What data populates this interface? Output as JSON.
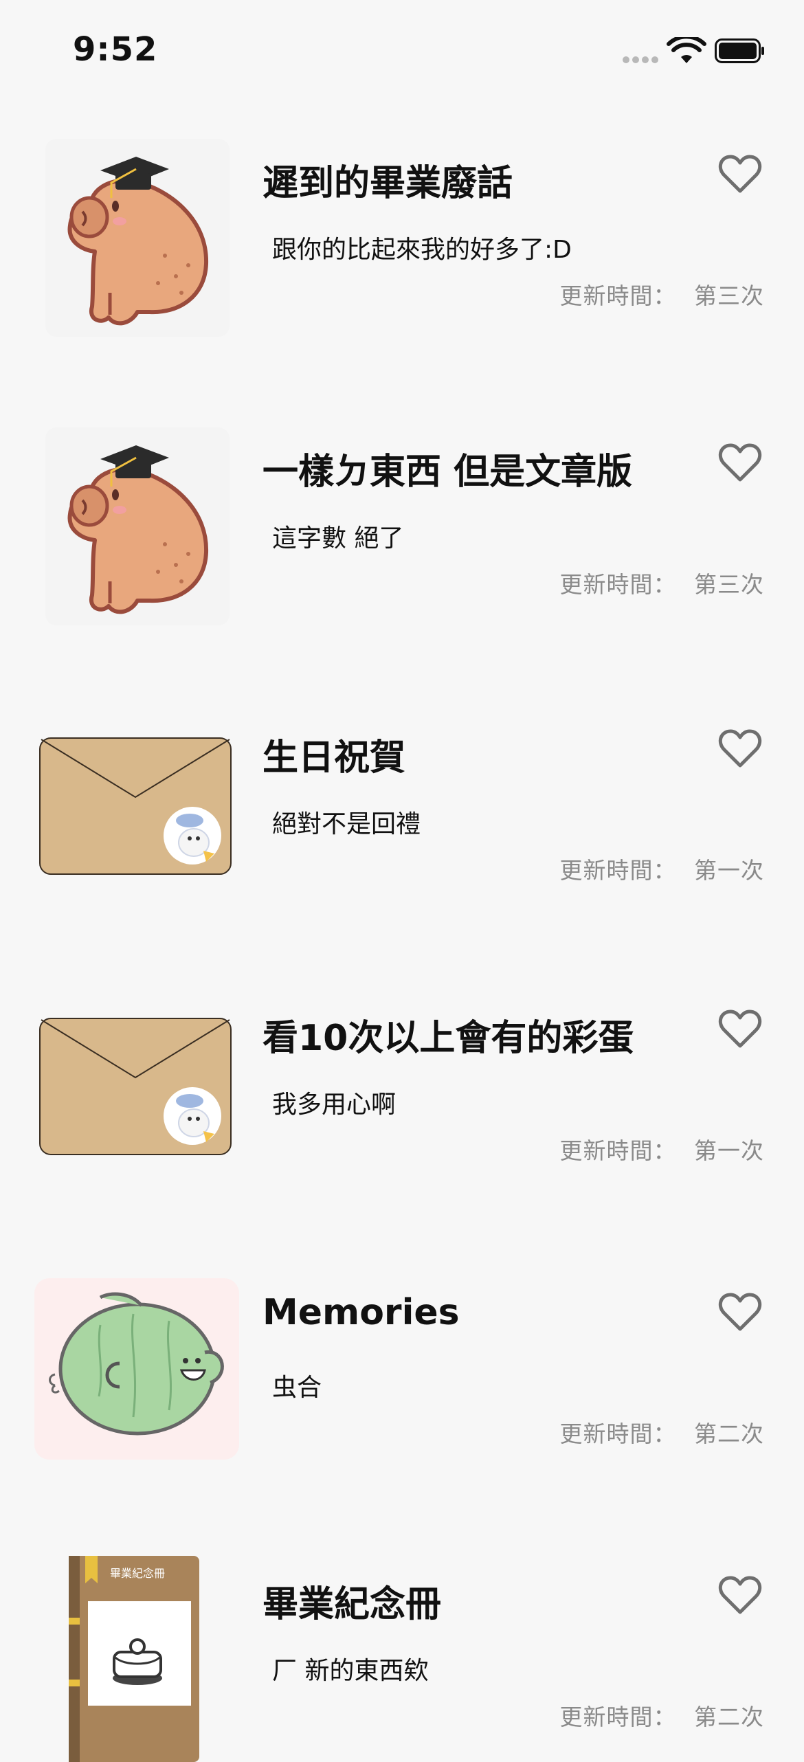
{
  "status_bar": {
    "time": "9:52"
  },
  "items": [
    {
      "title": "遲到的畢業廢話",
      "subtitle": "跟你的比起來我的好多了:D",
      "updated_label": "更新時間：",
      "updated_value": "第三次",
      "thumbnail": "capybara-graduation"
    },
    {
      "title": "一樣ㄉ東西  但是文章版",
      "subtitle": "這字數 絕了",
      "updated_label": "更新時間：",
      "updated_value": "第三次",
      "thumbnail": "capybara-graduation"
    },
    {
      "title": "生日祝賀",
      "subtitle": "絕對不是回禮",
      "updated_label": "更新時間：",
      "updated_value": "第一次",
      "thumbnail": "envelope"
    },
    {
      "title": "看10次以上會有的彩蛋",
      "subtitle": "我多用心啊",
      "updated_label": "更新時間：",
      "updated_value": "第一次",
      "thumbnail": "envelope"
    },
    {
      "title": "Memories",
      "subtitle": "虫合",
      "updated_label": "更新時間：",
      "updated_value": "第二次",
      "thumbnail": "melon-fish"
    },
    {
      "title": "畢業紀念冊",
      "subtitle": "厂 新的東西欸",
      "updated_label": "更新時間：",
      "updated_value": "第二次",
      "thumbnail": "yearbook",
      "yearbook_cover_text": "畢業紀念冊"
    }
  ],
  "icons": {
    "favorite": "heart-outline-icon",
    "wifi": "wifi-icon",
    "battery": "battery-icon"
  },
  "colors": {
    "background": "#f7f7f7",
    "title": "#111111",
    "meta": "#8a8a8a",
    "heart": "#6e6e6e",
    "envelope": "#d8b88b",
    "capybara": "#e8a77d",
    "melon": "#a9d6a2",
    "yearbook": "#a9845a"
  }
}
